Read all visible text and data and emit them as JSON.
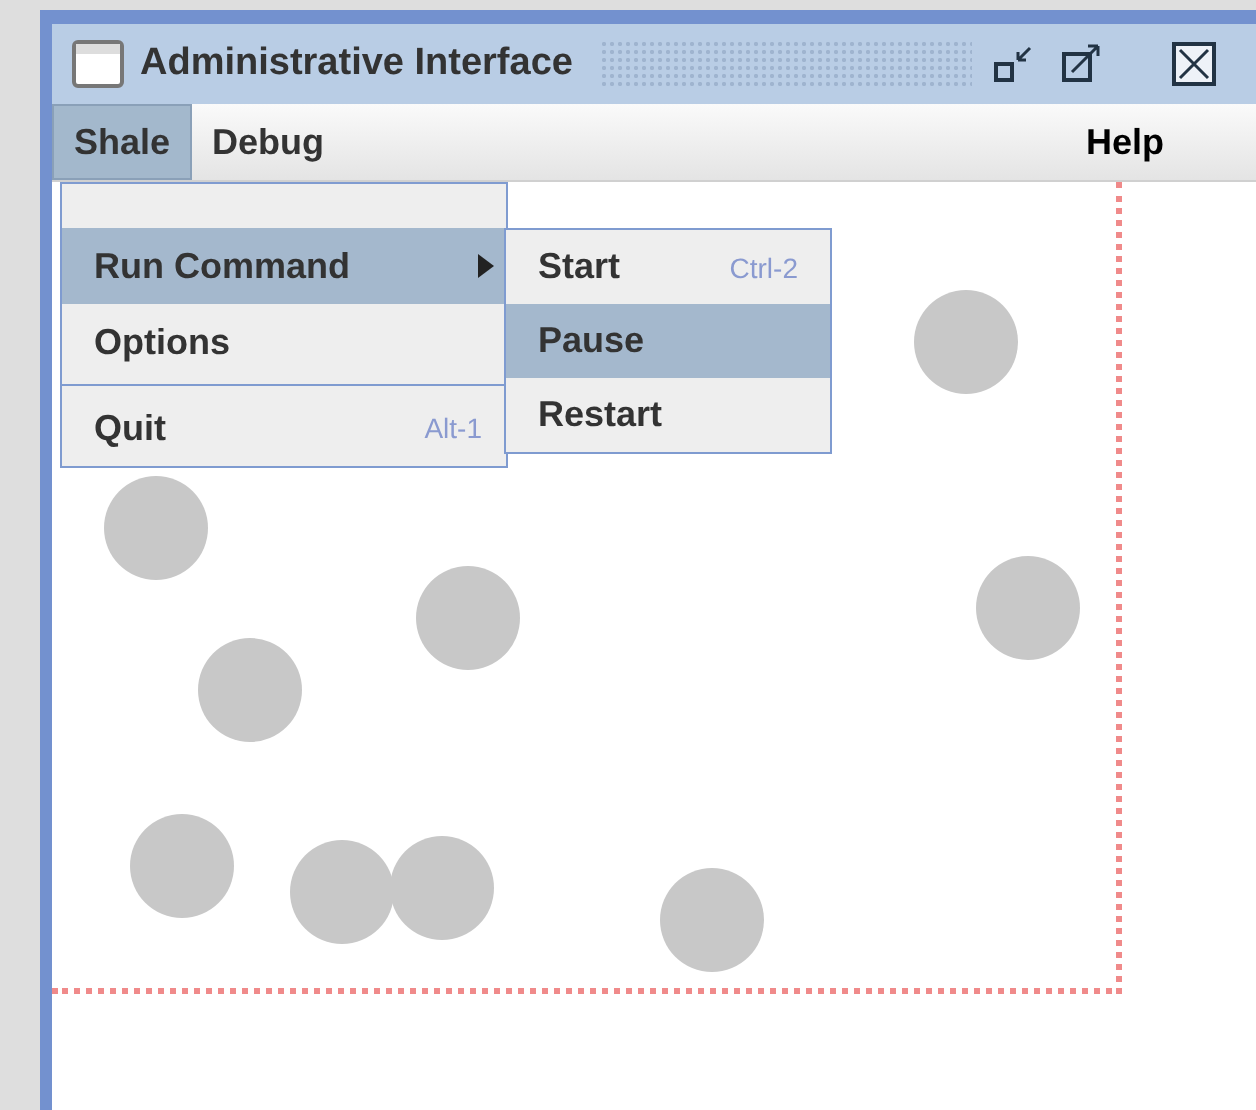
{
  "window": {
    "title": "Administrative Interface"
  },
  "menu_bar": [
    {
      "label": "Shale",
      "selected": true
    },
    {
      "label": "Debug",
      "selected": false
    },
    {
      "label": "Help",
      "selected": false
    }
  ],
  "dropdown": [
    {
      "kind": "blank"
    },
    {
      "kind": "submenu",
      "label": "Run Command",
      "selected": true
    },
    {
      "kind": "item",
      "label": "Options",
      "selected": false
    },
    {
      "kind": "separator"
    },
    {
      "kind": "item",
      "label": "Quit",
      "shortcut": "Alt-1",
      "selected": false
    }
  ],
  "submenu": [
    {
      "label": "Start",
      "shortcut": "Ctrl-2",
      "selected": false
    },
    {
      "label": "Pause",
      "selected": true
    },
    {
      "label": "Restart",
      "selected": false
    }
  ]
}
